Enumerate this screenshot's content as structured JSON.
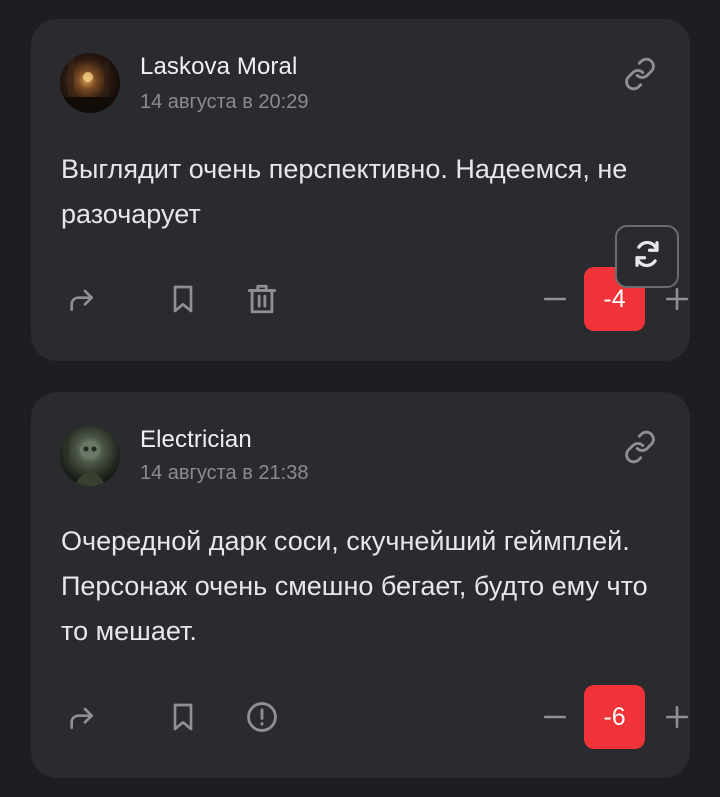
{
  "comments": [
    {
      "author": "Laskova Moral",
      "date": "14 августа в 20:29",
      "text": "Выглядит очень перспективно. Надеемся, не разочарует",
      "score": "-4",
      "actions": [
        "reply-icon",
        "bookmark-icon",
        "trash-icon"
      ]
    },
    {
      "author": "Electrician",
      "date": "14 августа в 21:38",
      "text": "Очередной дарк соси, скучнейший геймплей. Персонаж очень смешно бегает, будто ему что то мешает.",
      "score": "-6",
      "actions": [
        "reply-icon",
        "bookmark-icon",
        "report-icon"
      ]
    }
  ],
  "floating": {
    "icon": "refresh-icon"
  },
  "colors": {
    "background": "#1d1e21",
    "card": "#2a2b2e",
    "score_negative": "#f03338",
    "text_secondary": "#8a8c90",
    "icon": "#8e9094"
  }
}
